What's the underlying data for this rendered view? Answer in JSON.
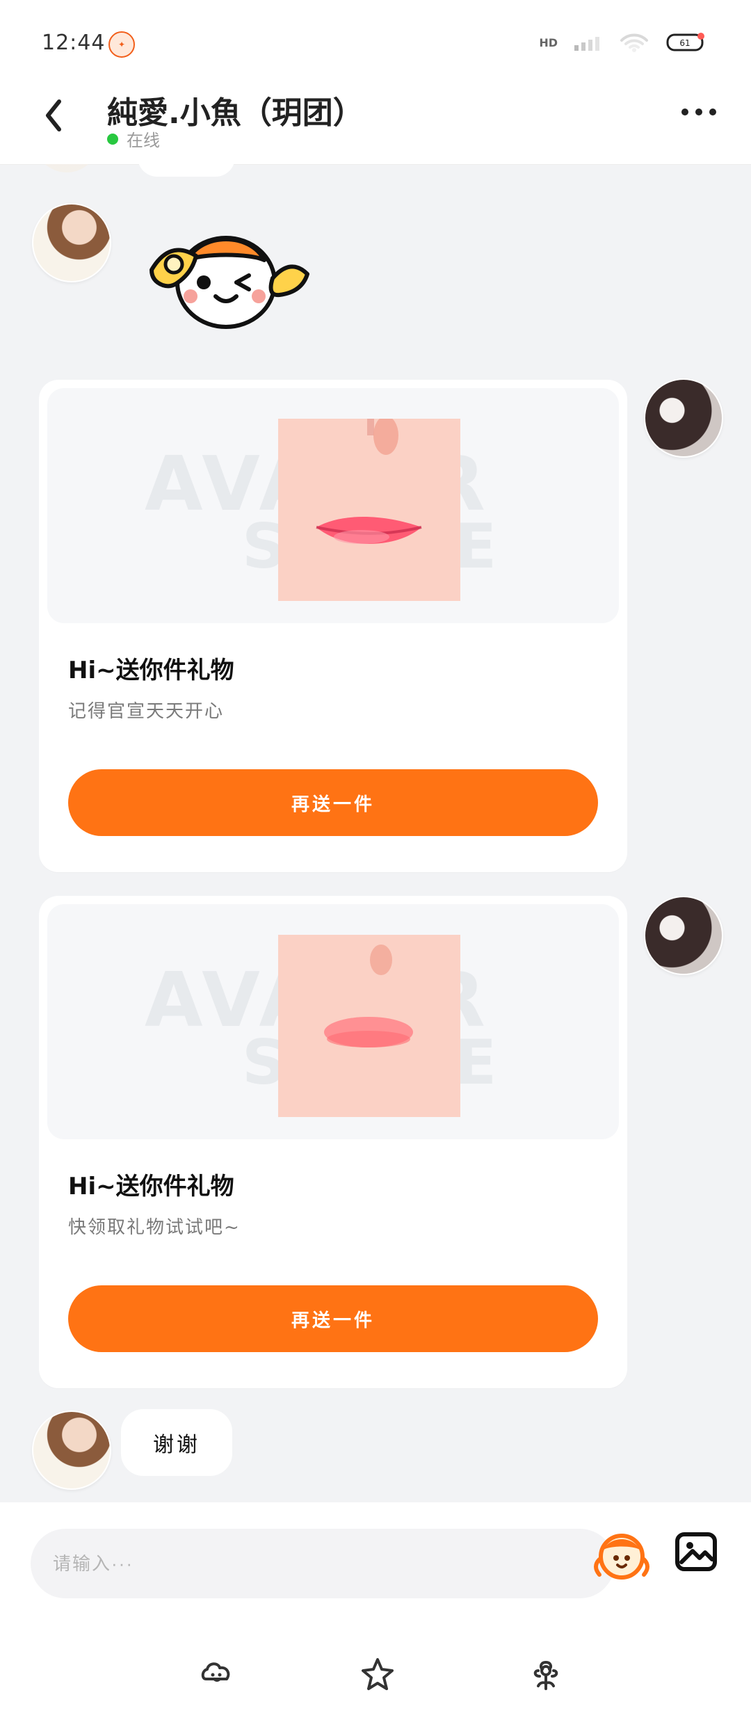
{
  "status_bar": {
    "time": "12:44",
    "network": "HD",
    "battery": "61"
  },
  "header": {
    "title": "純愛.小魚（玥团）",
    "presence": "在线"
  },
  "messages": {
    "thanks_text": "谢谢"
  },
  "gift_cards": [
    {
      "watermark_top": "AVATAR",
      "watermark_bottom": "STORE",
      "title": "Hi~送你件礼物",
      "description": "记得官宣天天开心",
      "button_label": "再送一件"
    },
    {
      "watermark_top": "AVATAR",
      "watermark_bottom": "STORE",
      "title": "Hi~送你件礼物",
      "description": "快领取礼物试试吧~",
      "button_label": "再送一件"
    }
  ],
  "composer": {
    "placeholder": "请输入···"
  },
  "colors": {
    "accent": "#FF7314",
    "online": "#28C840",
    "background": "#F2F3F5"
  },
  "icons": {
    "back": "chevron-left-icon",
    "more": "more-dots-icon",
    "emoji": "mascot-icon",
    "image": "image-icon",
    "tab1": "cloud-face-icon",
    "tab2": "star-icon",
    "tab3": "flower-icon"
  }
}
